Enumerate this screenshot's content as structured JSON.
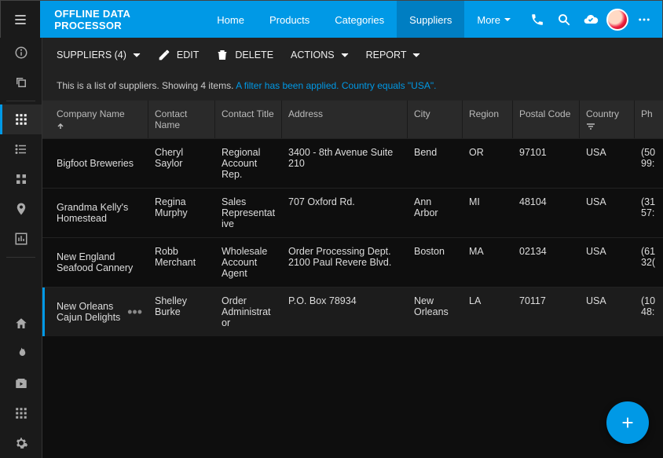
{
  "app": {
    "title": "OFFLINE DATA PROCESSOR"
  },
  "nav": {
    "home": "Home",
    "products": "Products",
    "categories": "Categories",
    "suppliers": "Suppliers",
    "more": "More"
  },
  "toolbar": {
    "suppliers": "SUPPLIERS (4)",
    "edit": "EDIT",
    "delete": "DELETE",
    "actions": "ACTIONS",
    "report": "REPORT"
  },
  "note": {
    "plain": "This is a list of suppliers. Showing 4 items. ",
    "filter_applied": "A filter has been applied.",
    "filter_detail": " Country equals \"USA\"."
  },
  "columns": {
    "company": "Company Name",
    "contact": "Contact Name",
    "title": "Contact Title",
    "address": "Address",
    "city": "City",
    "region": "Region",
    "postal": "Postal Code",
    "country": "Country",
    "phone": "Ph"
  },
  "rows": [
    {
      "company": "Bigfoot Breweries",
      "contact": "Cheryl Saylor",
      "title": "Regional Account Rep.",
      "address": "3400 - 8th Avenue Suite 210",
      "city": "Bend",
      "region": "OR",
      "postal": "97101",
      "country": "USA",
      "phone": "(50\n99:"
    },
    {
      "company": "Grandma Kelly's Homestead",
      "contact": "Regina Murphy",
      "title": "Sales Representative",
      "address": "707 Oxford Rd.",
      "city": "Ann Arbor",
      "region": "MI",
      "postal": "48104",
      "country": "USA",
      "phone": "(31\n57:"
    },
    {
      "company": "New England Seafood Cannery",
      "contact": "Robb Merchant",
      "title": "Wholesale Account Agent",
      "address": "Order Processing Dept. 2100 Paul Revere Blvd.",
      "city": "Boston",
      "region": "MA",
      "postal": "02134",
      "country": "USA",
      "phone": "(61\n32("
    },
    {
      "company": "New Orleans Cajun Delights",
      "contact": "Shelley Burke",
      "title": "Order Administrator",
      "address": "P.O. Box 78934",
      "city": "New Orleans",
      "region": "LA",
      "postal": "70117",
      "country": "USA",
      "phone": "(10\n48:"
    }
  ]
}
